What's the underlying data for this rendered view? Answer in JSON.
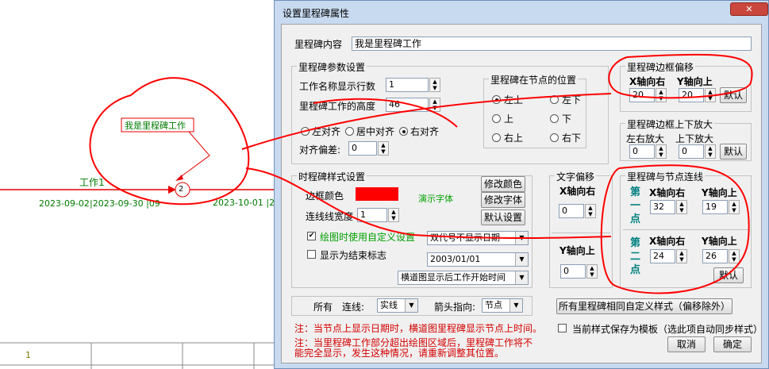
{
  "background": {
    "milestone_label": "我是里程碑工作",
    "task_label": "工作1",
    "node_number": "2",
    "date_a": "2023-09-02",
    "date_b": "|2023-09-30 |09",
    "date_c": "2023-10-01 |20",
    "row_number": "1",
    "colors": {
      "gantt_line": "#e80000",
      "gantt_text": "#007a00",
      "annotation": "#ff0000"
    }
  },
  "dialog": {
    "title": "设置里程碑属性",
    "close_glyph": "✕",
    "content_label": "里程碑内容",
    "content_value": "我是里程碑工作",
    "params": {
      "title": "里程碑参数设置",
      "rows_label": "工作名称显示行数",
      "rows_value": "1",
      "height_label": "里程碑工作的高度",
      "height_value": "46",
      "align_left": "左对齐",
      "align_center": "居中对齐",
      "align_right": "右对齐",
      "align_selected": "右对齐",
      "offset_label": "对齐偏差:",
      "offset_value": "0"
    },
    "position": {
      "title": "里程碑在节点的位置",
      "options": [
        "左上",
        "左下",
        "上",
        "下",
        "右上",
        "右下"
      ],
      "selected": "左上"
    },
    "border_offset": {
      "title": "里程碑边框偏移",
      "x_label": "X轴向右",
      "y_label": "Y轴向上",
      "x_value": "20",
      "y_value": "20",
      "default_button": "默认"
    },
    "border_scale": {
      "title": "里程碑边框上下放大",
      "lr_label": "左右放大",
      "ud_label": "上下放大",
      "lr_value": "0",
      "ud_value": "0",
      "default_button": "默认"
    },
    "style": {
      "title": "时程碑样式设置",
      "border_color_label": "边框颜色",
      "border_color": "#ff0000",
      "demo_font": "演示字体",
      "modify_color_button": "修改颜色",
      "modify_font_button": "修改字体",
      "default_settings_button": "默认设置",
      "line_width_label": "连线线宽度",
      "line_width_value": "1",
      "custom_check_label": "绘图时使用自定义设置",
      "custom_checked": true,
      "date_mode_value": "双代号不显示日期",
      "end_marker_label": "显示为结束标志",
      "end_marker_checked": false,
      "date_value": "2003/01/01",
      "crossbar_value": "横道图显示后工作开始时间"
    },
    "text_offset": {
      "title": "文字偏移",
      "x_label": "X轴向右",
      "x_value": "0",
      "y_label": "Y轴向上",
      "y_value": "0"
    },
    "node_line": {
      "title": "里程碑与节点连线",
      "first_point": "第一点",
      "second_point": "第二点",
      "x_label": "X轴向右",
      "y_label": "Y轴向上",
      "p1_x": "32",
      "p1_y": "19",
      "p2_x": "24",
      "p2_y": "26",
      "default_button": "默认"
    },
    "all_row": {
      "all_label": "所有",
      "line_label": "连线:",
      "line_value": "实线",
      "arrow_label": "箭头指向:",
      "arrow_value": "节点"
    },
    "apply_all_button": "所有里程碑相同自定义样式（偏移除外）",
    "save_template_label": "当前样式保存为模板（选此项自动同步样式）",
    "note1": "注：当节点上显示日期时，横道图里程碑显示节点上时间。",
    "note2_line1": "注：当里程碑工作部分超出绘图区域后，里程碑工作将不",
    "note2_line2": "能完全显示，发生这种情况，请重新调整其位置。",
    "cancel_button": "取消",
    "ok_button": "确定"
  }
}
